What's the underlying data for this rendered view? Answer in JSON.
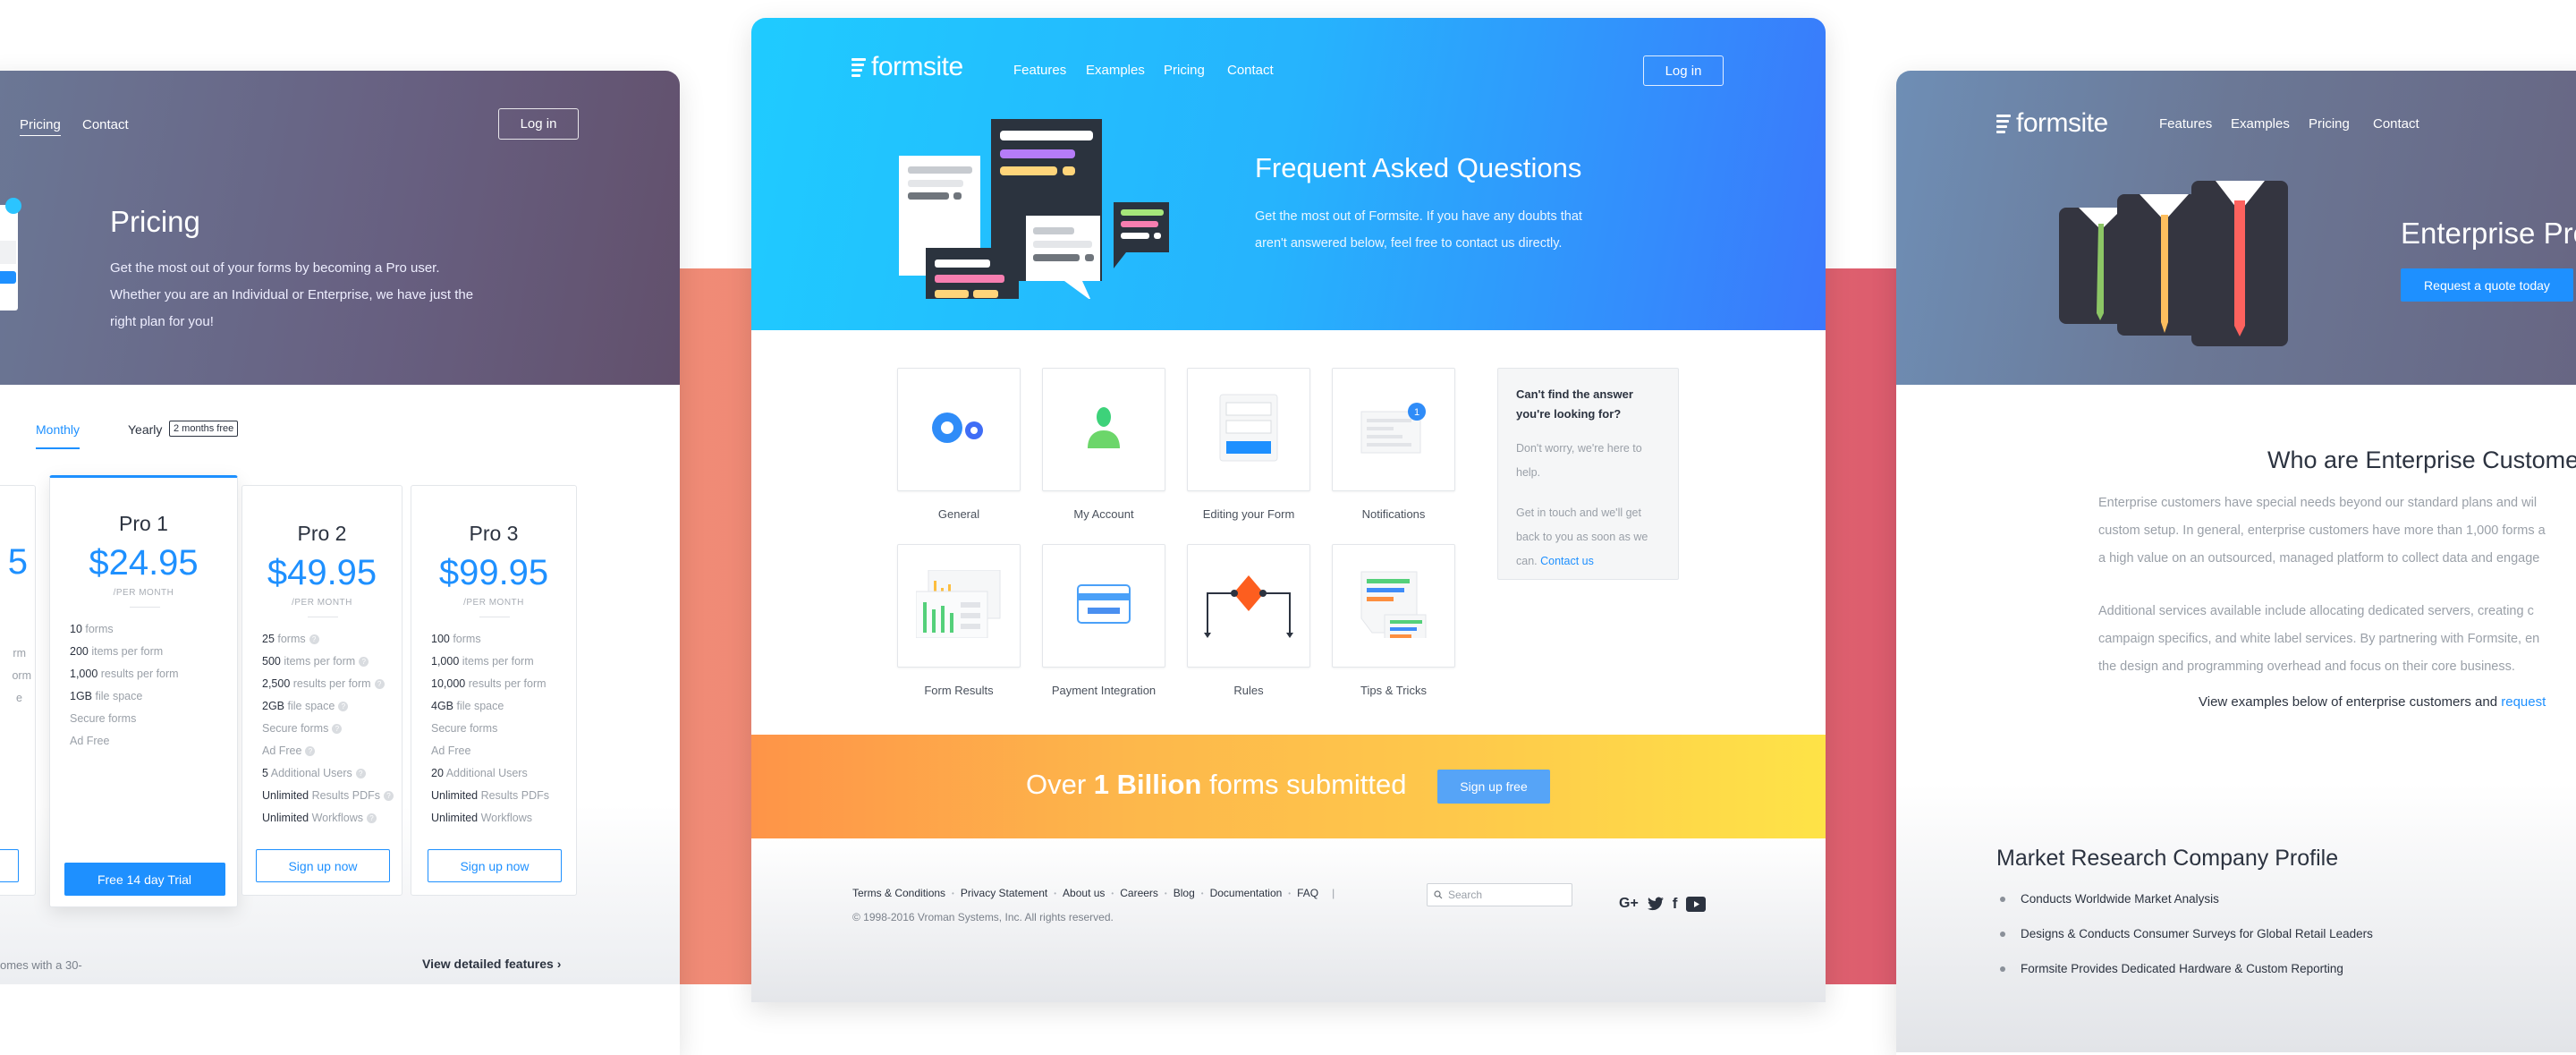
{
  "colors": {
    "accent": "#1e90ff",
    "purple_header": "#675f80",
    "blue_header": "#26b3fd",
    "banner_start": "#fe9647",
    "banner_end": "#fee347"
  },
  "pricing_page": {
    "nav": [
      "Pricing",
      "Contact"
    ],
    "login": "Log in",
    "title": "Pricing",
    "description": [
      "Get the most out of your forms by becoming a Pro user.",
      "Whether you are an Individual or Enterprise, we have just the",
      "right plan for you!"
    ],
    "tabs": {
      "monthly": "Monthly",
      "yearly": "Yearly",
      "badge": "2 months free"
    },
    "partial_card": {
      "price": "5",
      "features": [
        "rm",
        "orm",
        "e"
      ]
    },
    "plans": [
      {
        "name": "Pro 1",
        "price": "$24.95",
        "period": "/PER MONTH",
        "button": "Free 14 day Trial",
        "features": [
          {
            "strong": "10",
            "rest": " forms",
            "help": false
          },
          {
            "strong": "200",
            "rest": " items per form",
            "help": false
          },
          {
            "strong": "1,000",
            "rest": " results per form",
            "help": false
          },
          {
            "strong": "1GB",
            "rest": " file space",
            "help": false
          },
          {
            "strong": "",
            "rest": "Secure forms",
            "help": false
          },
          {
            "strong": "",
            "rest": "Ad Free",
            "help": false
          }
        ]
      },
      {
        "name": "Pro 2",
        "price": "$49.95",
        "period": "/PER MONTH",
        "button": "Sign up now",
        "features": [
          {
            "strong": "25",
            "rest": " forms",
            "help": true
          },
          {
            "strong": "500",
            "rest": " items per form",
            "help": true
          },
          {
            "strong": "2,500",
            "rest": " results per form",
            "help": true
          },
          {
            "strong": "2GB",
            "rest": " file space",
            "help": true
          },
          {
            "strong": "",
            "rest": "Secure forms",
            "help": true
          },
          {
            "strong": "",
            "rest": "Ad Free",
            "help": true
          },
          {
            "strong": "5",
            "rest": " Additional Users",
            "help": true
          },
          {
            "strong": "Unlimited",
            "rest": " Results PDFs",
            "help": true
          },
          {
            "strong": "Unlimited",
            "rest": " Workflows",
            "help": true
          }
        ]
      },
      {
        "name": "Pro 3",
        "price": "$99.95",
        "period": "/PER MONTH",
        "button": "Sign up now",
        "features": [
          {
            "strong": "100",
            "rest": " forms",
            "help": false
          },
          {
            "strong": "1,000",
            "rest": " items per form",
            "help": false
          },
          {
            "strong": "10,000",
            "rest": " results per form",
            "help": false
          },
          {
            "strong": "4GB",
            "rest": " file space",
            "help": false
          },
          {
            "strong": "",
            "rest": "Secure forms",
            "help": false
          },
          {
            "strong": "",
            "rest": "Ad Free",
            "help": false
          },
          {
            "strong": "20",
            "rest": " Additional Users",
            "help": false
          },
          {
            "strong": "Unlimited",
            "rest": " Results PDFs",
            "help": false
          },
          {
            "strong": "Unlimited",
            "rest": " Workflows",
            "help": false
          }
        ]
      }
    ],
    "footnote": "omes with a 30-",
    "detailed_link": "View detailed features",
    "detailed_chevron": "›"
  },
  "faq_page": {
    "logo": "formsite",
    "nav": [
      "Features",
      "Examples",
      "Pricing",
      "Contact"
    ],
    "login": "Log in",
    "title": "Frequent Asked Questions",
    "description": [
      "Get the most out of Formsite. If you have any doubts that",
      "aren't answered below, feel free to contact us directly."
    ],
    "categories": [
      {
        "label": "General",
        "icon": "gears-icon"
      },
      {
        "label": "My Account",
        "icon": "user-icon"
      },
      {
        "label": "Editing your Form",
        "icon": "form-icon"
      },
      {
        "label": "Notifications",
        "icon": "notification-icon"
      },
      {
        "label": "Form Results",
        "icon": "chart-icon"
      },
      {
        "label": "Payment Integration",
        "icon": "credit-card-icon"
      },
      {
        "label": "Rules",
        "icon": "flowchart-icon"
      },
      {
        "label": "Tips & Tricks",
        "icon": "chat-tips-icon"
      }
    ],
    "notification_count": "1",
    "help_box": {
      "title": "Can't find the answer you're looking for?",
      "text1": "Don't worry, we're here to help.",
      "text2": "Get in touch and we'll get back to you as soon as we can.",
      "link": "Contact us"
    },
    "banner": {
      "prefix": "Over ",
      "bold": "1 Billion",
      "suffix": " forms submitted",
      "button": "Sign up free"
    },
    "footer": {
      "links": [
        "Terms & Conditions",
        "Privacy Statement",
        "About us",
        "Careers",
        "Blog",
        "Documentation",
        "FAQ"
      ],
      "search_placeholder": "Search",
      "copyright": "© 1998-2016 Vroman Systems, Inc. All rights reserved.",
      "social": [
        "google-plus-icon",
        "twitter-icon",
        "facebook-icon",
        "youtube-icon"
      ]
    }
  },
  "enterprise_page": {
    "logo": "formsite",
    "nav": [
      "Features",
      "Examples",
      "Pricing",
      "Contact"
    ],
    "title": "Enterprise Pro",
    "cta": "Request a quote today",
    "section_title": "Who are Enterprise Customer",
    "paragraph1": [
      "Enterprise customers have special needs beyond our standard plans and wil",
      "custom setup. In general, enterprise customers have more than 1,000 forms a",
      "a high value on an outsourced, managed platform to collect data and engage"
    ],
    "paragraph2": [
      "Additional services available include allocating dedicated servers, creating c",
      "campaign specifics, and white label services. By partnering with Formsite, en",
      "the design and programming overhead and focus on their core business."
    ],
    "examples_text": "View examples below of enterprise customers and ",
    "examples_link": "request",
    "profile_title": "Market Research Company Profile",
    "profile_items": [
      "Conducts Worldwide Market Analysis",
      "Designs & Conducts Consumer Surveys for Global Retail Leaders",
      "Formsite Provides Dedicated Hardware & Custom Reporting"
    ]
  }
}
